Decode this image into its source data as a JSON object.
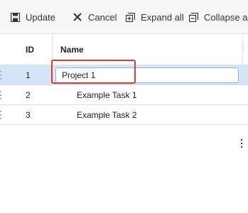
{
  "toolbar": {
    "update": {
      "label": "Update",
      "icon": "save-icon"
    },
    "cancel": {
      "label": "Cancel",
      "icon": "close-icon"
    },
    "expand_all": {
      "label": "Expand all",
      "icon": "expand-all-icon"
    },
    "collapse_all": {
      "label": "Collapse all",
      "icon": "collapse-all-icon"
    }
  },
  "grid": {
    "columns": {
      "id": "ID",
      "name": "Name"
    },
    "rows": [
      {
        "id": "1",
        "name": "Project 1",
        "editing": true
      },
      {
        "id": "2",
        "name": "Example Task 1"
      },
      {
        "id": "3",
        "name": "Example Task 2"
      }
    ]
  },
  "colors": {
    "editing_row": "#d6e4f7",
    "highlight": "#d83a3a",
    "toolbar_bg": "#f7f7f7"
  }
}
